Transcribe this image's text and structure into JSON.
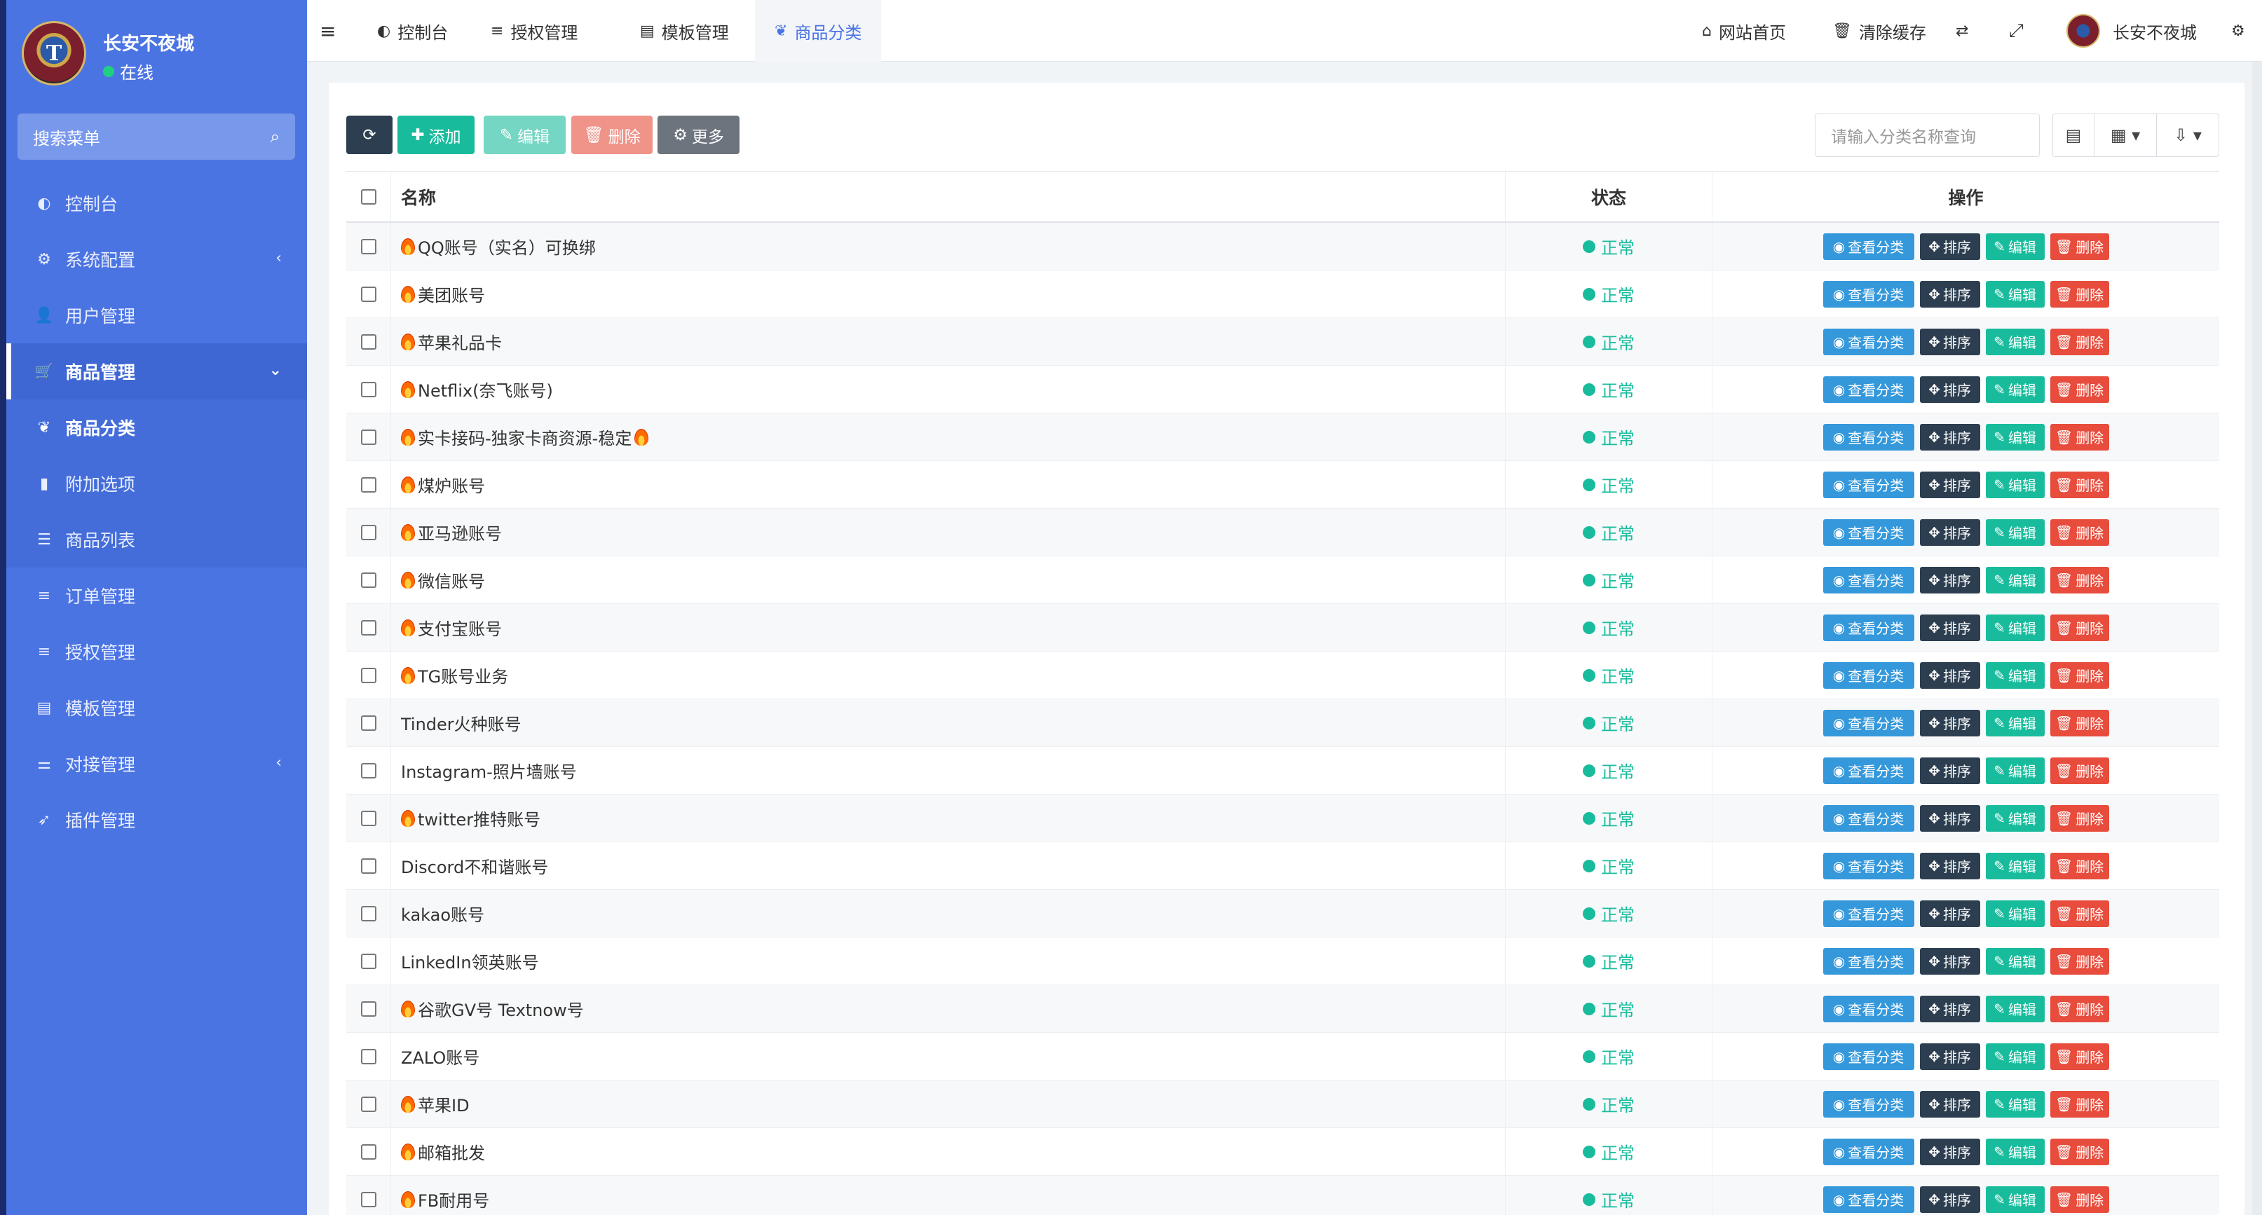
{
  "sidebar": {
    "user_name": "长安不夜城",
    "user_status": "在线",
    "avatar_text": "T",
    "search_placeholder": "搜索菜单",
    "items": [
      {
        "label": "控制台",
        "icon": "dashboard-icon",
        "glyph": "◐"
      },
      {
        "label": "系统配置",
        "icon": "gear-icon",
        "glyph": "⚙",
        "arrow": "‹"
      },
      {
        "label": "用户管理",
        "icon": "user-icon",
        "glyph": "👤"
      },
      {
        "label": "商品管理",
        "icon": "cart-icon",
        "glyph": "🛒",
        "arrow": "⌄"
      },
      {
        "label": "商品分类",
        "icon": "leaf-icon",
        "glyph": "❦"
      },
      {
        "label": "附加选项",
        "icon": "bookmark-icon",
        "glyph": "▮"
      },
      {
        "label": "商品列表",
        "icon": "list-icon",
        "glyph": "☰"
      },
      {
        "label": "订单管理",
        "icon": "menu-icon",
        "glyph": "≡"
      },
      {
        "label": "授权管理",
        "icon": "menu-icon",
        "glyph": "≡"
      },
      {
        "label": "模板管理",
        "icon": "window-icon",
        "glyph": "▤"
      },
      {
        "label": "对接管理",
        "icon": "sliders-icon",
        "glyph": "⚌",
        "arrow": "‹"
      },
      {
        "label": "插件管理",
        "icon": "rocket-icon",
        "glyph": "➶"
      }
    ]
  },
  "topnav": {
    "tabs": [
      {
        "label": "控制台",
        "glyph": "◐"
      },
      {
        "label": "授权管理",
        "glyph": "≡"
      },
      {
        "label": "模板管理",
        "glyph": "▤"
      },
      {
        "label": "商品分类",
        "glyph": "❦"
      }
    ],
    "right": {
      "home": "网站首页",
      "clear_cache": "清除缓存",
      "user": "长安不夜城"
    }
  },
  "toolbar": {
    "add": "添加",
    "edit": "编辑",
    "delete": "删除",
    "more": "更多",
    "search_placeholder": "请输入分类名称查询"
  },
  "table": {
    "headers": {
      "name": "名称",
      "status": "状态",
      "ops": "操作"
    },
    "op_labels": {
      "view": "查看分类",
      "sort": "排序",
      "edit": "编辑",
      "delete": "删除"
    },
    "rows": [
      {
        "name": "QQ账号（实名）可换绑",
        "fire": true,
        "fire_end": false,
        "status": "正常"
      },
      {
        "name": "美团账号",
        "fire": true,
        "fire_end": false,
        "status": "正常"
      },
      {
        "name": "苹果礼品卡",
        "fire": true,
        "fire_end": false,
        "status": "正常"
      },
      {
        "name": "Netflix(奈飞账号)",
        "fire": true,
        "fire_end": false,
        "status": "正常"
      },
      {
        "name": "实卡接码-独家卡商资源-稳定",
        "fire": true,
        "fire_end": true,
        "status": "正常"
      },
      {
        "name": "煤炉账号",
        "fire": true,
        "fire_end": false,
        "status": "正常"
      },
      {
        "name": "亚马逊账号",
        "fire": true,
        "fire_end": false,
        "status": "正常"
      },
      {
        "name": "微信账号",
        "fire": true,
        "fire_end": false,
        "status": "正常"
      },
      {
        "name": "支付宝账号",
        "fire": true,
        "fire_end": false,
        "status": "正常"
      },
      {
        "name": "TG账号业务",
        "fire": true,
        "fire_end": false,
        "status": "正常"
      },
      {
        "name": "Tinder火种账号",
        "fire": false,
        "fire_end": false,
        "status": "正常"
      },
      {
        "name": "Instagram-照片墙账号",
        "fire": false,
        "fire_end": false,
        "status": "正常"
      },
      {
        "name": "twitter推特账号",
        "fire": true,
        "fire_end": false,
        "status": "正常"
      },
      {
        "name": "Discord不和谐账号",
        "fire": false,
        "fire_end": false,
        "status": "正常"
      },
      {
        "name": "kakao账号",
        "fire": false,
        "fire_end": false,
        "status": "正常"
      },
      {
        "name": "LinkedIn领英账号",
        "fire": false,
        "fire_end": false,
        "status": "正常"
      },
      {
        "name": "谷歌GV号 Textnow号",
        "fire": true,
        "fire_end": false,
        "status": "正常"
      },
      {
        "name": "ZALO账号",
        "fire": false,
        "fire_end": false,
        "status": "正常"
      },
      {
        "name": "苹果ID",
        "fire": true,
        "fire_end": false,
        "status": "正常"
      },
      {
        "name": "邮箱批发",
        "fire": true,
        "fire_end": false,
        "status": "正常"
      },
      {
        "name": "FB耐用号",
        "fire": true,
        "fire_end": false,
        "status": "正常"
      }
    ]
  },
  "colors": {
    "sidebar": "#4b74e3",
    "success": "#18bc9c",
    "danger": "#e74c3c",
    "info": "#3498db",
    "dark": "#2c3e50"
  }
}
